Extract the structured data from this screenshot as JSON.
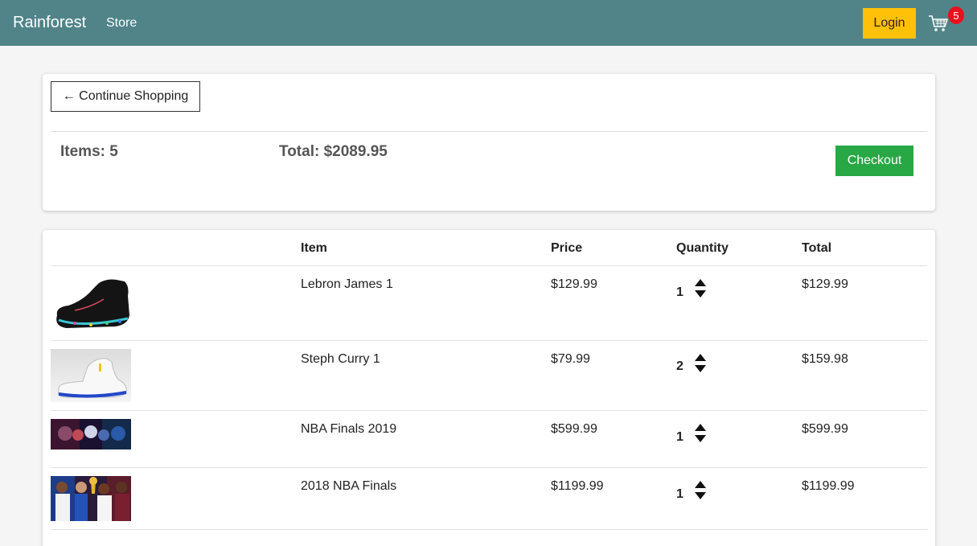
{
  "navbar": {
    "brand": "Rainforest",
    "store_link": "Store",
    "login_label": "Login",
    "cart_icon": "shopping-cart-icon",
    "cart_count": "5",
    "bg_color": "#508489"
  },
  "summary": {
    "continue_label": "← Continue Shopping",
    "items_text": "Items: 5",
    "total_text": "Total: $2089.95",
    "checkout_label": "Checkout"
  },
  "table": {
    "headers": [
      "",
      "Item",
      "Price",
      "Quantity",
      "Total"
    ],
    "rows": [
      {
        "image": "sneaker-black-product-image",
        "item": "Lebron James 1",
        "price": "$129.99",
        "quantity": "1",
        "total": "$129.99"
      },
      {
        "image": "sneaker-white-product-image",
        "item": "Steph Curry 1",
        "price": "$79.99",
        "quantity": "2",
        "total": "$159.98"
      },
      {
        "image": "nba-finals-banner-image",
        "item": "NBA Finals 2019",
        "price": "$599.99",
        "quantity": "1",
        "total": "$599.99"
      },
      {
        "image": "nba-finals-players-image",
        "item": "2018 NBA Finals",
        "price": "$1199.99",
        "quantity": "1",
        "total": "$1199.99"
      }
    ]
  },
  "colors": {
    "login": "#ffc107",
    "checkout": "#28a745",
    "badge": "#e8121e"
  }
}
